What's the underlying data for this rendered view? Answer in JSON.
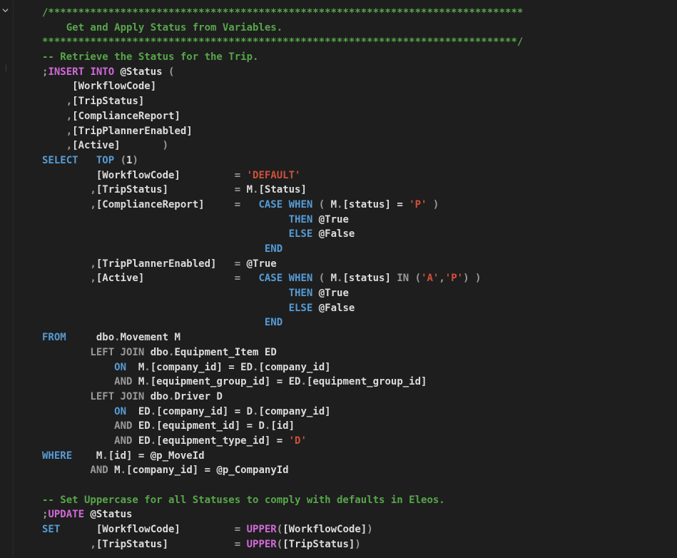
{
  "editor": {
    "language": "sql",
    "colors": {
      "background": "#1e1e1e",
      "comment": "#57a64a",
      "keyword": "#569cd6",
      "gray_keyword": "#9a9a9a",
      "string": "#d0503d",
      "identifier": "#dcdcdc",
      "function": "#d26ad8"
    },
    "lines": [
      [
        [
          "comment",
          "/*******************************************************************************"
        ]
      ],
      [
        [
          "comment",
          "    Get and Apply Status from Variables."
        ]
      ],
      [
        [
          "comment",
          "*******************************************************************************/"
        ]
      ],
      [
        [
          "comment",
          "-- Retrieve the Status for the Trip."
        ]
      ],
      [
        [
          "gray",
          ";"
        ],
        [
          "func",
          "INSERT INTO "
        ],
        [
          "ident",
          "@Status "
        ],
        [
          "gray",
          "("
        ]
      ],
      [
        [
          "ident",
          "     [WorkflowCode]"
        ]
      ],
      [
        [
          "gray",
          "    ,"
        ],
        [
          "ident",
          "[TripStatus]"
        ]
      ],
      [
        [
          "gray",
          "    ,"
        ],
        [
          "ident",
          "[ComplianceReport]"
        ]
      ],
      [
        [
          "gray",
          "    ,"
        ],
        [
          "ident",
          "[TripPlannerEnabled]"
        ]
      ],
      [
        [
          "gray",
          "    ,"
        ],
        [
          "ident",
          "[Active]"
        ],
        [
          "gray",
          "       )"
        ]
      ],
      [
        [
          "keyword",
          "SELECT   TOP "
        ],
        [
          "gray",
          "("
        ],
        [
          "ident",
          "1"
        ],
        [
          "gray",
          ")"
        ]
      ],
      [
        [
          "ident",
          "         [WorkflowCode]"
        ],
        [
          "gray",
          "         = "
        ],
        [
          "string",
          "'DEFAULT'"
        ]
      ],
      [
        [
          "gray",
          "        ,"
        ],
        [
          "ident",
          "[TripStatus]"
        ],
        [
          "gray",
          "           = "
        ],
        [
          "ident",
          "M"
        ],
        [
          "gray",
          "."
        ],
        [
          "ident",
          "[Status]"
        ]
      ],
      [
        [
          "gray",
          "        ,"
        ],
        [
          "ident",
          "[ComplianceReport]"
        ],
        [
          "gray",
          "     =   "
        ],
        [
          "keyword",
          "CASE WHEN "
        ],
        [
          "gray",
          "( "
        ],
        [
          "ident",
          "M"
        ],
        [
          "gray",
          "."
        ],
        [
          "ident",
          "[status] = "
        ],
        [
          "string",
          "'P'"
        ],
        [
          "gray",
          " )"
        ]
      ],
      [
        [
          "keyword",
          "                                         THEN "
        ],
        [
          "ident",
          "@True"
        ]
      ],
      [
        [
          "keyword",
          "                                         ELSE "
        ],
        [
          "ident",
          "@False"
        ]
      ],
      [
        [
          "keyword",
          "                                     END"
        ]
      ],
      [
        [
          "gray",
          "        ,"
        ],
        [
          "ident",
          "[TripPlannerEnabled]"
        ],
        [
          "gray",
          "   = "
        ],
        [
          "ident",
          "@True"
        ]
      ],
      [
        [
          "gray",
          "        ,"
        ],
        [
          "ident",
          "[Active]"
        ],
        [
          "gray",
          "               =   "
        ],
        [
          "keyword",
          "CASE WHEN "
        ],
        [
          "gray",
          "( "
        ],
        [
          "ident",
          "M"
        ],
        [
          "gray",
          "."
        ],
        [
          "ident",
          "[status] "
        ],
        [
          "gray",
          "IN ("
        ],
        [
          "string",
          "'A'"
        ],
        [
          "gray",
          ","
        ],
        [
          "string",
          "'P'"
        ],
        [
          "gray",
          ") )"
        ]
      ],
      [
        [
          "keyword",
          "                                         THEN "
        ],
        [
          "ident",
          "@True"
        ]
      ],
      [
        [
          "keyword",
          "                                         ELSE "
        ],
        [
          "ident",
          "@False"
        ]
      ],
      [
        [
          "keyword",
          "                                     END"
        ]
      ],
      [
        [
          "keyword",
          "FROM     "
        ],
        [
          "ident",
          "dbo"
        ],
        [
          "gray",
          "."
        ],
        [
          "ident",
          "Movement M"
        ]
      ],
      [
        [
          "gray",
          "        LEFT JOIN "
        ],
        [
          "ident",
          "dbo"
        ],
        [
          "gray",
          "."
        ],
        [
          "ident",
          "Equipment_Item ED"
        ]
      ],
      [
        [
          "keyword",
          "            ON  "
        ],
        [
          "ident",
          "M"
        ],
        [
          "gray",
          "."
        ],
        [
          "ident",
          "[company_id] = ED"
        ],
        [
          "gray",
          "."
        ],
        [
          "ident",
          "[company_id]"
        ]
      ],
      [
        [
          "gray",
          "            AND "
        ],
        [
          "ident",
          "M"
        ],
        [
          "gray",
          "."
        ],
        [
          "ident",
          "[equipment_group_id] = ED"
        ],
        [
          "gray",
          "."
        ],
        [
          "ident",
          "[equipment_group_id]"
        ]
      ],
      [
        [
          "gray",
          "        LEFT JOIN "
        ],
        [
          "ident",
          "dbo"
        ],
        [
          "gray",
          "."
        ],
        [
          "ident",
          "Driver D"
        ]
      ],
      [
        [
          "keyword",
          "            ON  "
        ],
        [
          "ident",
          "ED"
        ],
        [
          "gray",
          "."
        ],
        [
          "ident",
          "[company_id] = D"
        ],
        [
          "gray",
          "."
        ],
        [
          "ident",
          "[company_id]"
        ]
      ],
      [
        [
          "gray",
          "            AND "
        ],
        [
          "ident",
          "ED"
        ],
        [
          "gray",
          "."
        ],
        [
          "ident",
          "[equipment_id] = D"
        ],
        [
          "gray",
          "."
        ],
        [
          "ident",
          "[id]"
        ]
      ],
      [
        [
          "gray",
          "            AND "
        ],
        [
          "ident",
          "ED"
        ],
        [
          "gray",
          "."
        ],
        [
          "ident",
          "[equipment_type_id] = "
        ],
        [
          "string",
          "'D'"
        ]
      ],
      [
        [
          "keyword",
          "WHERE    "
        ],
        [
          "ident",
          "M"
        ],
        [
          "gray",
          "."
        ],
        [
          "ident",
          "[id] = @p_MoveId"
        ]
      ],
      [
        [
          "gray",
          "        AND "
        ],
        [
          "ident",
          "M"
        ],
        [
          "gray",
          "."
        ],
        [
          "ident",
          "[company_id] = @p_CompanyId"
        ]
      ],
      [
        [
          "ident",
          ""
        ]
      ],
      [
        [
          "comment",
          "-- Set Uppercase for all Statuses to comply with defaults in Eleos."
        ]
      ],
      [
        [
          "gray",
          ";"
        ],
        [
          "func",
          "UPDATE "
        ],
        [
          "ident",
          "@Status"
        ]
      ],
      [
        [
          "keyword",
          "SET      "
        ],
        [
          "ident",
          "[WorkflowCode]"
        ],
        [
          "gray",
          "         = "
        ],
        [
          "func",
          "UPPER"
        ],
        [
          "gray",
          "("
        ],
        [
          "ident",
          "[WorkflowCode]"
        ],
        [
          "gray",
          ")"
        ]
      ],
      [
        [
          "gray",
          "        ,"
        ],
        [
          "ident",
          "[TripStatus]"
        ],
        [
          "gray",
          "           = "
        ],
        [
          "func",
          "UPPER"
        ],
        [
          "gray",
          "("
        ],
        [
          "ident",
          "[TripStatus]"
        ],
        [
          "gray",
          ")"
        ]
      ]
    ]
  },
  "gutter": {
    "fold_icon": "chevron-down-icon"
  }
}
